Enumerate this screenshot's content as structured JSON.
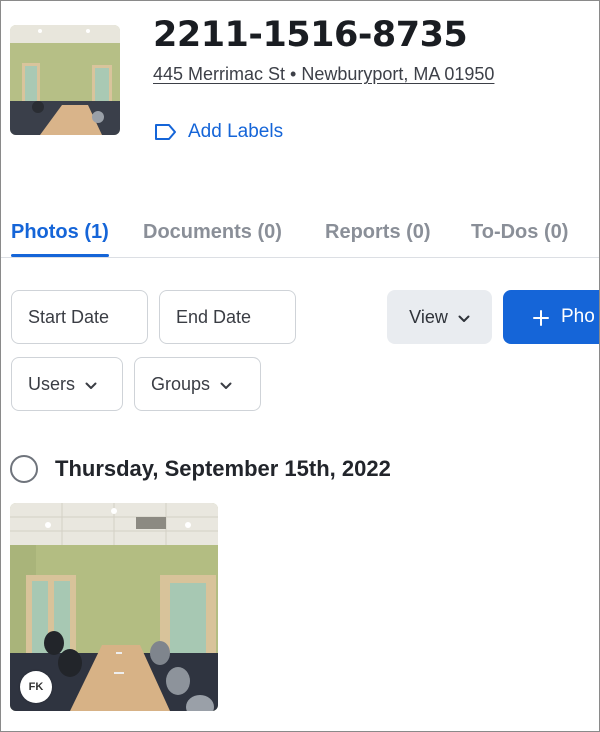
{
  "project": {
    "title": "2211-1516-8735",
    "address": "445 Merrimac St • Newburyport, MA 01950",
    "add_labels": "Add Labels",
    "thumbnail_icon": "conference-room-photo"
  },
  "tabs": [
    {
      "label": "Photos (1)",
      "active": true
    },
    {
      "label": "Documents (0)",
      "active": false
    },
    {
      "label": "Reports (0)",
      "active": false
    },
    {
      "label": "To-Dos (0)",
      "active": false
    }
  ],
  "filters": {
    "start_date": "Start Date",
    "end_date": "End Date",
    "view": "View",
    "add_photo": "Pho",
    "users": "Users",
    "groups": "Groups"
  },
  "groups": [
    {
      "date": "Thursday, September 15th, 2022",
      "photos": [
        {
          "uploader_initials": "FK",
          "icon": "conference-room-photo"
        }
      ]
    }
  ],
  "colors": {
    "accent": "#1565d8",
    "tab_inactive": "#8a8f98",
    "view_button_bg": "#e9ecf0"
  }
}
